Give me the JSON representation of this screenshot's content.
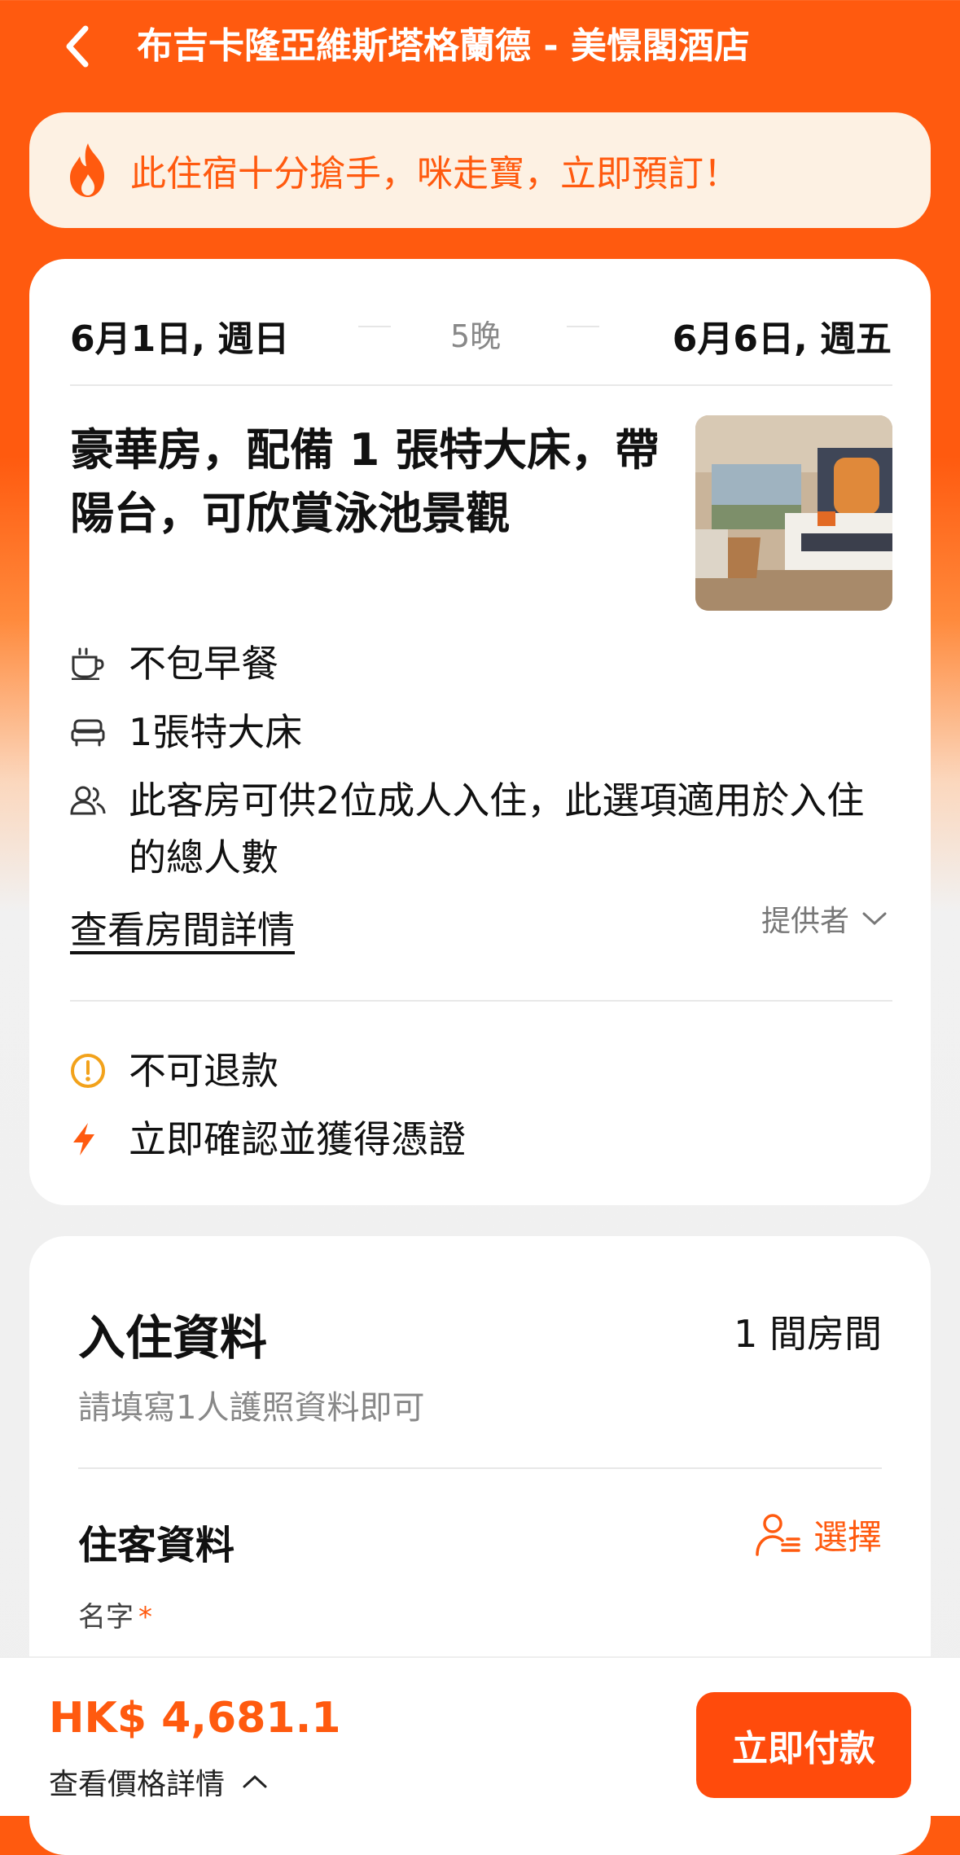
{
  "header": {
    "back_icon": "chevron-left-icon",
    "title": "布吉卡隆亞維斯塔格蘭德 - 美憬閣酒店"
  },
  "promo": {
    "icon": "fire-icon",
    "text": "此住宿十分搶手，咪走寶，立即預訂！"
  },
  "stay": {
    "check_in": "6月1日, 週日",
    "nights": "5晚",
    "check_out": "6月6日, 週五"
  },
  "room": {
    "name": "豪華房，配備 1 張特大床，帶陽台，可欣賞泳池景觀",
    "features": [
      {
        "icon": "coffee-cup-icon",
        "text": "不包早餐"
      },
      {
        "icon": "bed-icon",
        "text": "1張特大床"
      },
      {
        "icon": "guests-icon",
        "text": "此客房可供2位成人入住，此選項適用於入住的總人數"
      }
    ],
    "details_link": "查看房間詳情",
    "provider_label": "提供者"
  },
  "policies": [
    {
      "icon": "alert-circle-icon",
      "text": "不可退款",
      "color": "#f2a21b"
    },
    {
      "icon": "lightning-icon",
      "text": "立即確認並獲得憑證",
      "color": "#ff5a0f"
    }
  ],
  "checkin_info": {
    "title": "入住資料",
    "rooms": "1 間房間",
    "hint": "請填寫1人護照資料即可",
    "guest_title": "住客資料",
    "select_label": "選擇",
    "name_label": "名字",
    "required_mark": "*"
  },
  "footer": {
    "price": "HK$ 4,681.1",
    "price_details": "查看價格詳情",
    "pay_label": "立即付款"
  },
  "colors": {
    "brand": "#ff5a0f",
    "promo_bg": "#fdf1e3",
    "warning": "#f2a21b"
  }
}
